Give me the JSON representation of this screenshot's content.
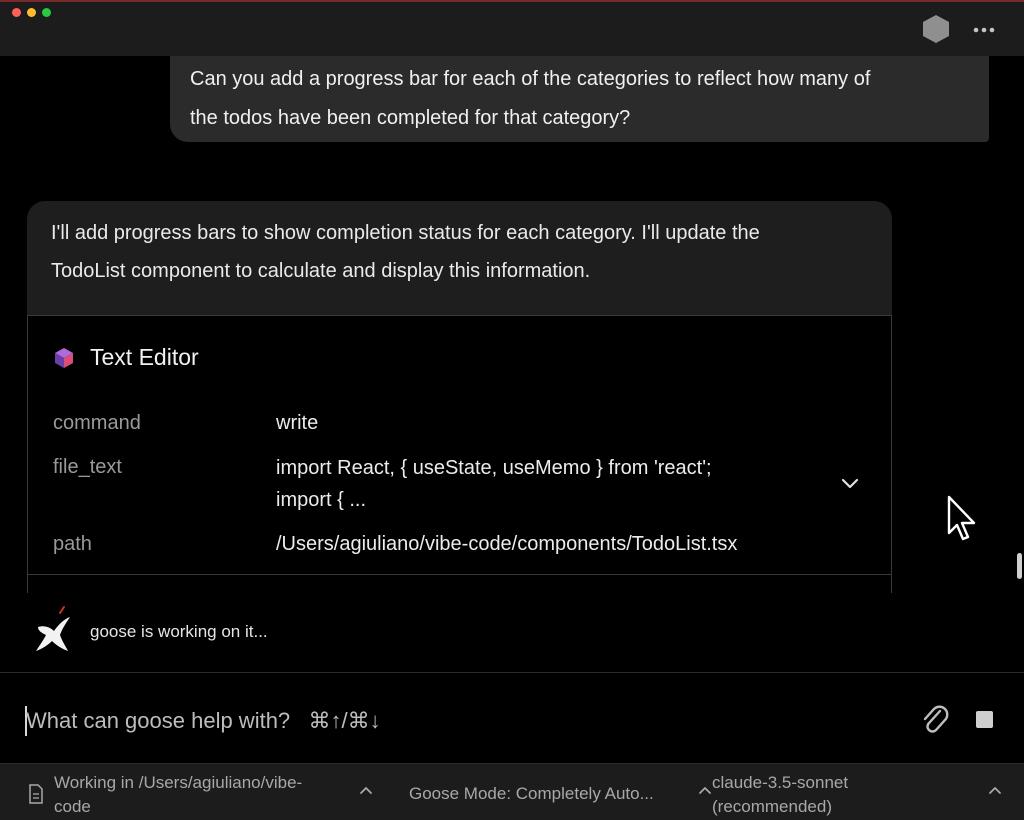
{
  "colors": {
    "background": "#000000",
    "bubble": "#2b2b2b",
    "card": "#1e1e1e",
    "bar": "#1c1c1c",
    "muted_text": "#9a9a9a"
  },
  "user_message": {
    "line1": "Can you add a progress bar for each of the categories to reflect how many of",
    "line2": "the todos have been completed for that category?"
  },
  "assistant_message": {
    "line1": "I'll add progress bars to show completion status for each category. I'll update the",
    "line2": "TodoList component to calculate and display this information."
  },
  "tool": {
    "icon": "cube-icon",
    "title": "Text Editor",
    "params": {
      "command": {
        "key": "command",
        "value": "write"
      },
      "file_text": {
        "key": "file_text",
        "value_line1": "import React, { useState, useMemo } from 'react';",
        "value_line2": "import { ..."
      },
      "path": {
        "key": "path",
        "value": "/Users/agiuliano/vibe-code/components/TodoList.tsx"
      }
    }
  },
  "status": {
    "icon": "goose-icon",
    "text": "goose is working on it..."
  },
  "input": {
    "placeholder": "What can goose help with?   ⌘↑/⌘↓"
  },
  "bottom_bar": {
    "workdir_line1": "Working in /Users/agiuliano/vibe-",
    "workdir_line2": "code",
    "mode": "Goose Mode: Completely Auto...",
    "model_line1": "claude-3.5-sonnet",
    "model_line2": "(recommended)"
  }
}
